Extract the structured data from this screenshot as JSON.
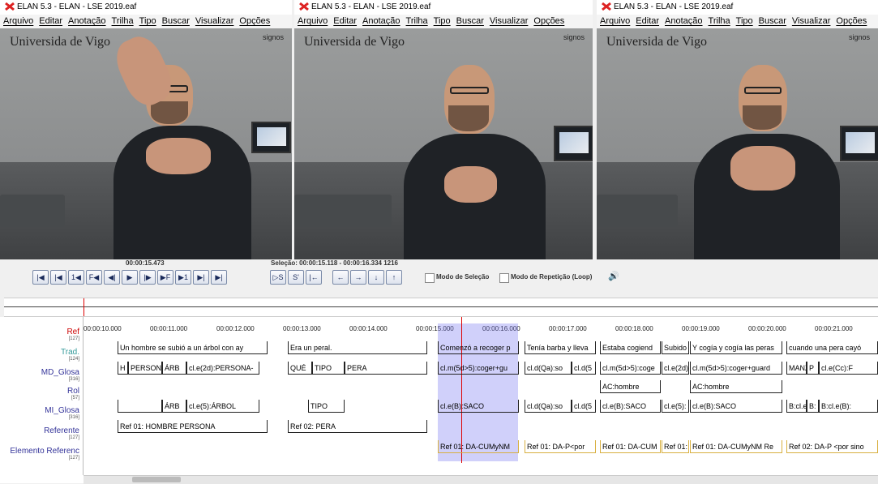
{
  "windows": [
    {
      "title": "ELAN 5.3 - ELAN - LSE 2019.eaf"
    },
    {
      "title": "ELAN 5.3 - ELAN - LSE 2019.eaf"
    },
    {
      "title": "ELAN 5.3 - ELAN - LSE 2019.eaf"
    }
  ],
  "menu": [
    "Arquivo",
    "Editar",
    "Anotação",
    "Trilha",
    "Tipo",
    "Buscar",
    "Visualizar",
    "Opções"
  ],
  "video": {
    "logo_text": "Universida de Vigo",
    "signos_text": "signos"
  },
  "controls": {
    "current_time": "00:00:15.473",
    "selection": "Seleção: 00:00:15.118 - 00:00:16.334  1216",
    "transport": [
      "|◀",
      "|◀",
      "1◀",
      "F◀",
      "◀|",
      "▶",
      "|▶",
      "▶F",
      "▶1",
      "▶|",
      "▶|"
    ],
    "sel_buttons": [
      "▷S",
      "S'",
      "|←"
    ],
    "arrows": [
      "←",
      "→",
      "↓",
      "↑"
    ],
    "mode_selection": "Modo de Seleção",
    "mode_loop": "Modo de Repetição (Loop)",
    "volume_icon": "🔊"
  },
  "ruler": [
    "00:00:10.000",
    "00:00:11.000",
    "00:00:12.000",
    "00:00:13.000",
    "00:00:14.000",
    "00:00:15.000",
    "00:00:16.000",
    "00:00:17.000",
    "00:00:18.000",
    "00:00:19.000",
    "00:00:20.000",
    "00:00:21.000"
  ],
  "tiers": [
    {
      "name": "Ref",
      "count": "[127]",
      "color": "#cc0000"
    },
    {
      "name": "Trad.",
      "count": "[124]",
      "color": "#339999"
    },
    {
      "name": "MD_Glosa",
      "count": "[316]",
      "color": "#333399"
    },
    {
      "name": "Rol",
      "count": "[57]",
      "color": "#333399"
    },
    {
      "name": "MI_Glosa",
      "count": "[316]",
      "color": "#333399"
    },
    {
      "name": "Referente",
      "count": "[127]",
      "color": "#333399"
    },
    {
      "name": "Elemento Referenc",
      "count": "[127]",
      "color": "#333399"
    }
  ],
  "annotations": {
    "trad": [
      "Un hombre se subió a un árbol con ay",
      "Era un peral.",
      "Comenzó a recoger p",
      "Tenía barba y lleva",
      "Estaba cogiend",
      "Subido",
      "Y cogía y cogía las peras",
      "cuando una pera cayó"
    ],
    "md": [
      "H",
      "PERSON",
      "ÁRB",
      "cl.e(2d):PERSONA-",
      "QUÉ",
      "TIPO",
      "PERA",
      "cl.m(5d>5):coger+gu",
      "cl.d(Qa):so",
      "cl.d(5",
      "cl.m(5d>5):coge",
      "cl.e(2d)",
      "cl.m(5d>5):coger+guard",
      "MANZ-",
      "P",
      "cl.e(Cc):F"
    ],
    "rol": [
      "AC:hombre",
      "AC:hombre"
    ],
    "mi": [
      "ÁRB",
      "cl.e(5):ÁRBOL",
      "TIPO",
      "cl.e(B):SACO",
      "cl.d(Qa):so",
      "cl.d(5",
      "cl.e(B):SACO",
      "cl.e(5):",
      "cl.e(B):SACO",
      "B:cl.e(",
      "B:",
      "B:cl.e(B):"
    ],
    "referente": [
      "Ref 01: HOMBRE PERSONA",
      "Ref 02: PERA"
    ],
    "elemento": [
      "Ref 01: DA-CUMyNM",
      "Ref 01: DA-P<por",
      "Ref 01: DA-CUM",
      "Ref 01:",
      "Ref 01:  DA-CUMyNM Re",
      "Ref 02: DA-P <por sino"
    ]
  }
}
